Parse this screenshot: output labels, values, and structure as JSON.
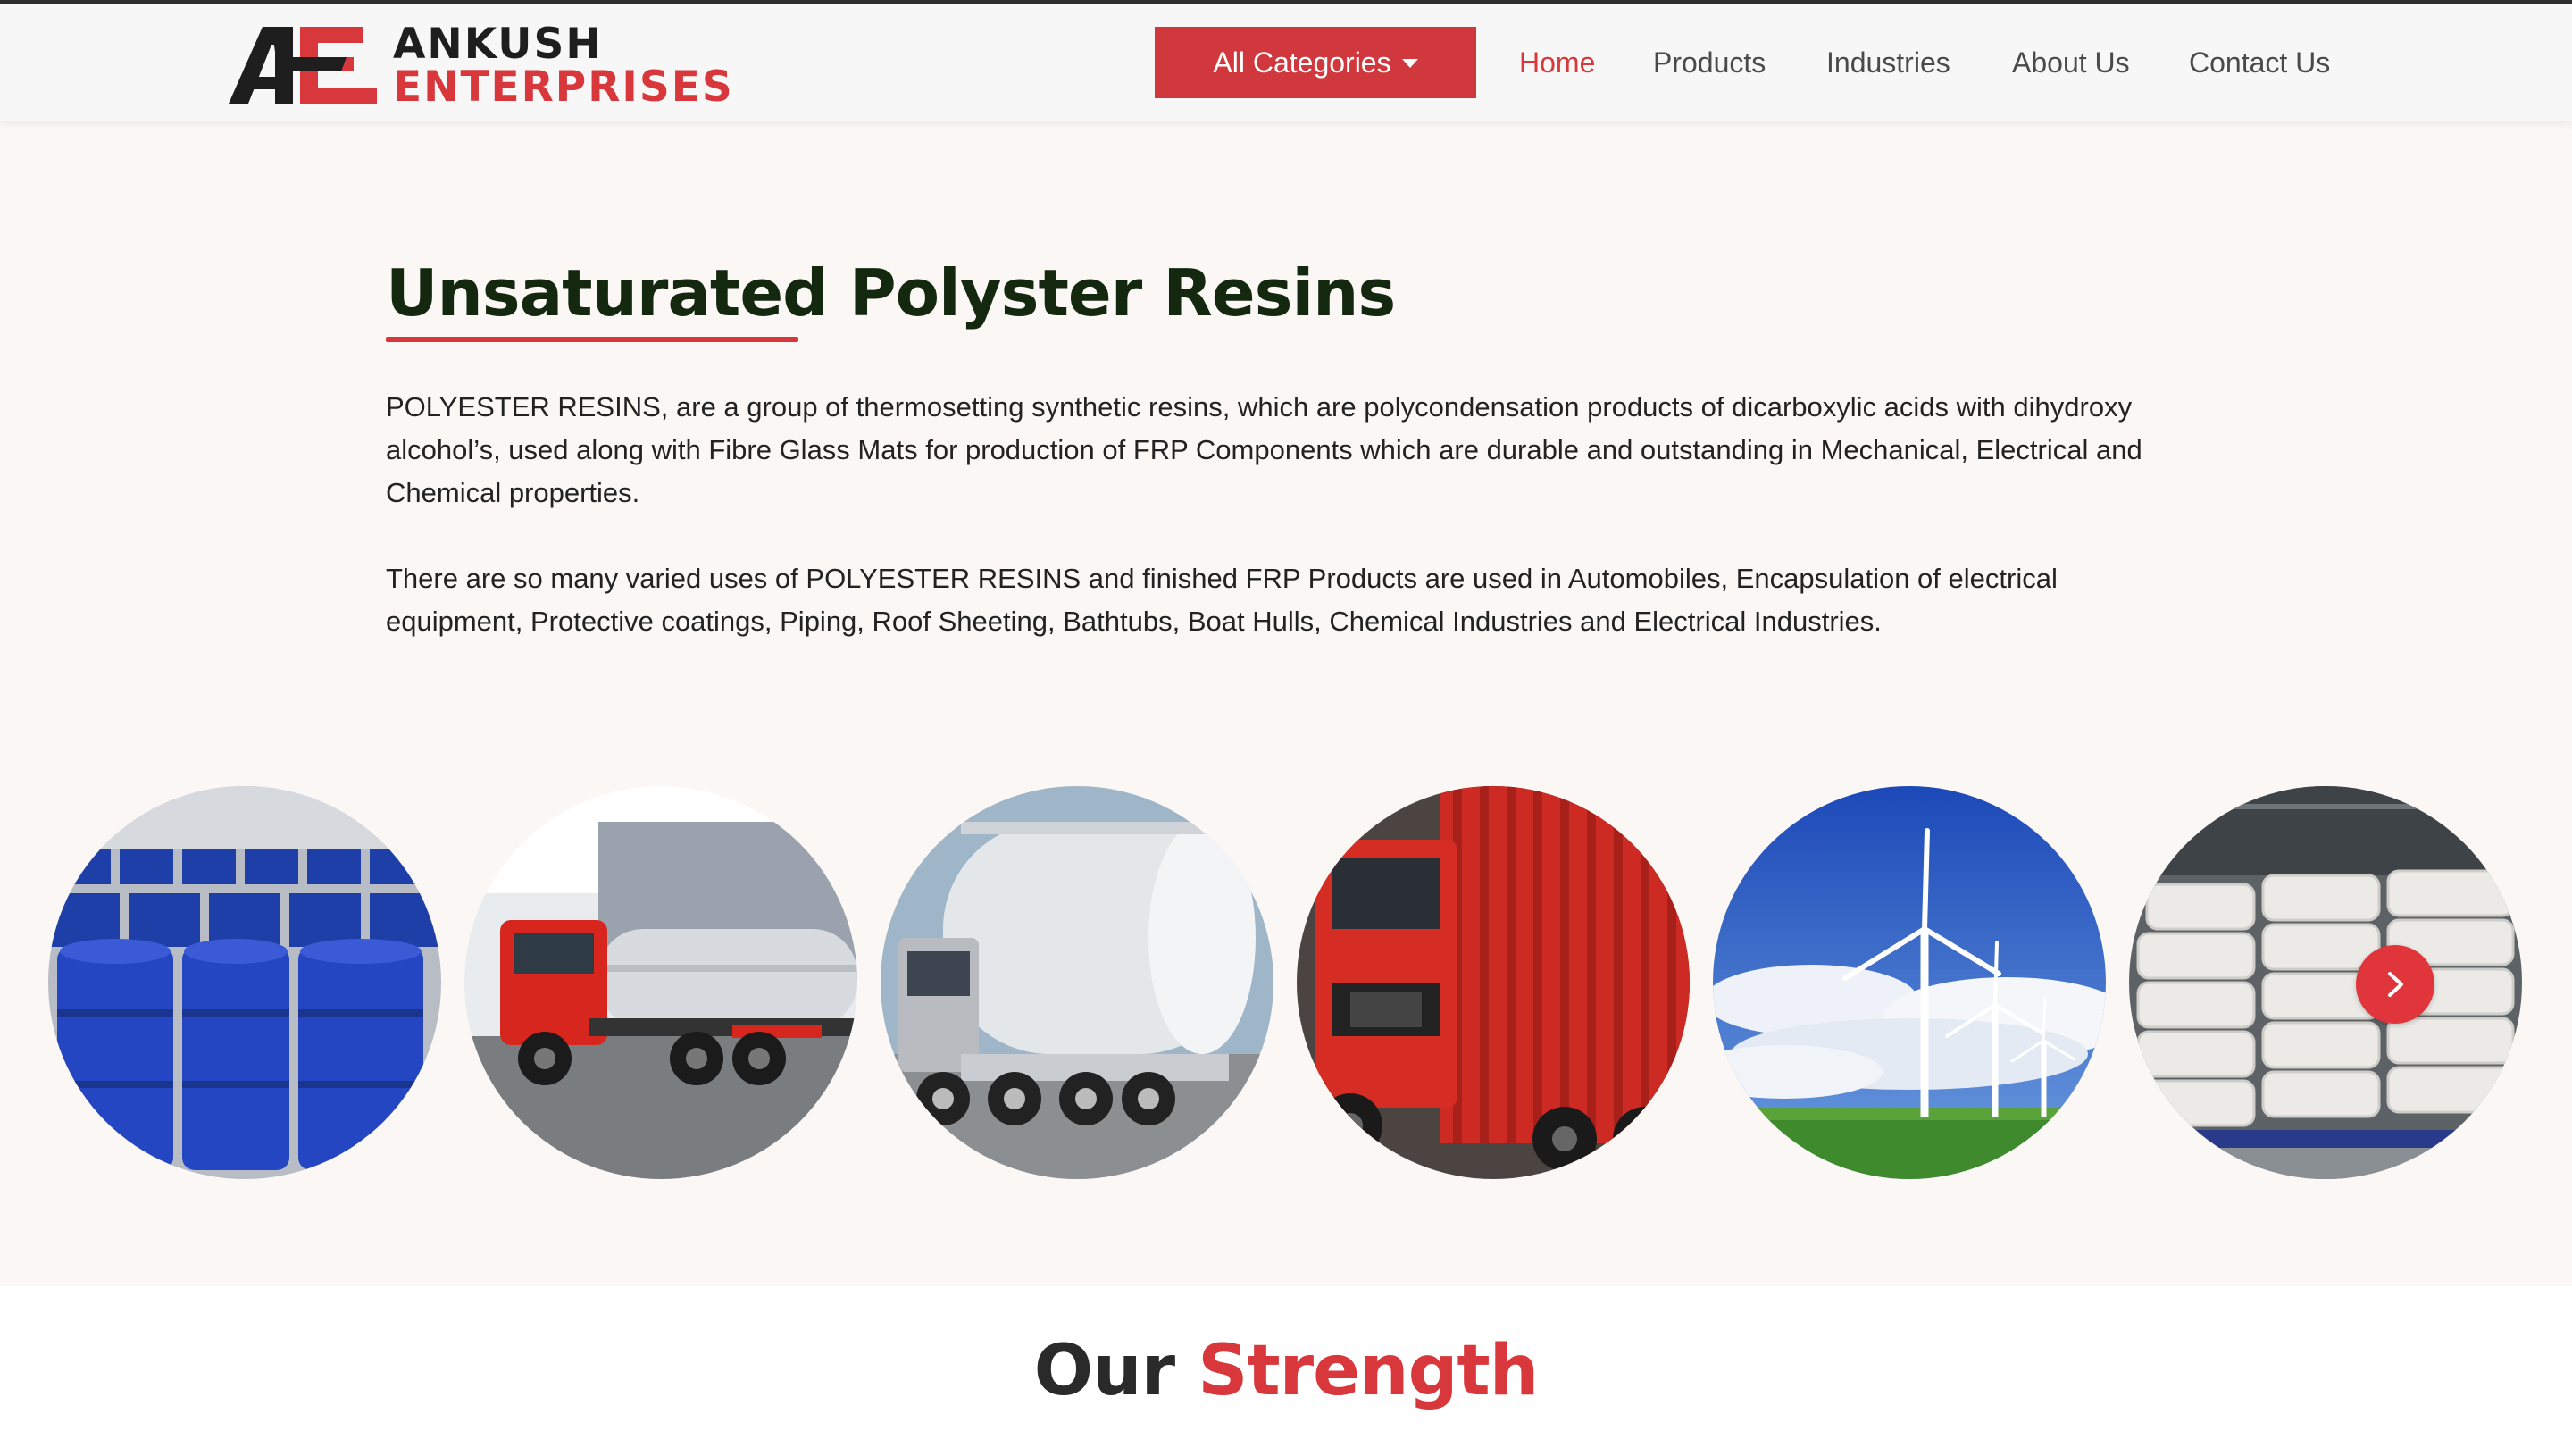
{
  "brand": {
    "line1": "ANKUSH",
    "line2": "ENTERPRISES",
    "colors": {
      "accent": "#d8373b",
      "dark": "#1e1e1e"
    }
  },
  "header": {
    "categories_label": "All Categories",
    "nav": {
      "home": "Home",
      "products": "Products",
      "industries": "Industries",
      "about": "About Us",
      "contact": "Contact Us"
    }
  },
  "main": {
    "title_part1": "Unsaturated",
    "title_part2": "Polyster Resins",
    "paragraph1": "POLYESTER RESINS, are a group of thermosetting synthetic resins, which are polycondensation products of dicarboxylic acids with dihydroxy alcohol’s, used along with Fibre Glass Mats for production of FRP Components which are durable and outstanding in Mechanical, Electrical and Chemical properties.",
    "paragraph2": " There are so many varied uses of POLYESTER RESINS and finished FRP Products are used in Automobiles, Encapsulation of electrical equipment, Protective coatings, Piping, Roof Sheeting, Bathtubs, Boat Hulls, Chemical Industries and Electrical Industries."
  },
  "carousel": {
    "items": [
      "blue-drums-image",
      "red-tanker-truck-image",
      "steel-tanker-image",
      "red-cargo-truck-image",
      "wind-turbines-image",
      "white-sacks-warehouse-image"
    ],
    "next_icon": "chevron-right-icon"
  },
  "strength": {
    "part1": "Our ",
    "part2": "Strength"
  }
}
